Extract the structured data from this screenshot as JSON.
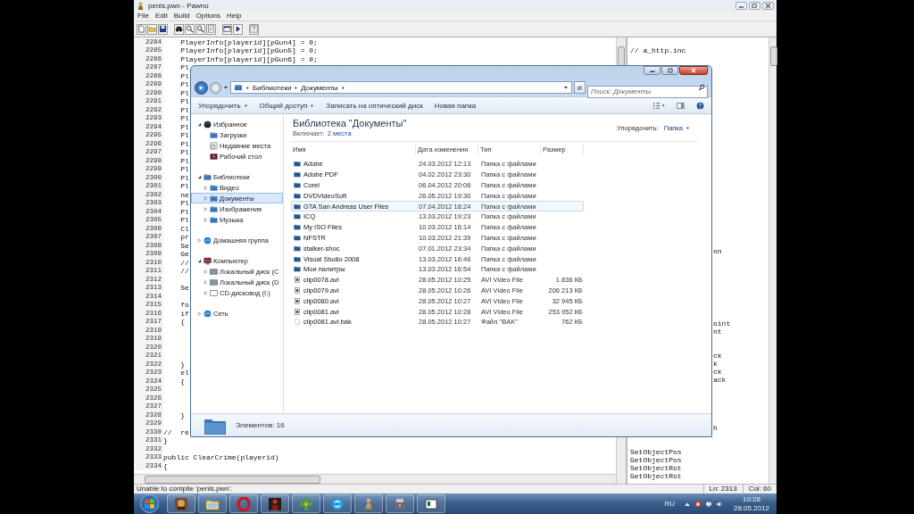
{
  "editor_window": {
    "title": "penls.pwn - Pawno",
    "menu": [
      "File",
      "Edit",
      "Build",
      "Options",
      "Help"
    ],
    "code_lines": [
      {
        "number": "2284",
        "text": "    PlayerInfo[playerid][pGun4] = 0;"
      },
      {
        "number": "2285",
        "text": "    PlayerInfo[playerid][pGun5] = 0;"
      },
      {
        "number": "2286",
        "text": "    PlayerInfo[playerid][pGun6] = 0;"
      },
      {
        "number": "2287",
        "text": "    Pl"
      },
      {
        "number": "2288",
        "text": "    Pl"
      },
      {
        "number": "2289",
        "text": "    Pl"
      },
      {
        "number": "2290",
        "text": "    Pl"
      },
      {
        "number": "2291",
        "text": "    Pl"
      },
      {
        "number": "2292",
        "text": "    Pl"
      },
      {
        "number": "2293",
        "text": "    Pl"
      },
      {
        "number": "2294",
        "text": "    Pl"
      },
      {
        "number": "2295",
        "text": "    Pl"
      },
      {
        "number": "2296",
        "text": "    Pl"
      },
      {
        "number": "2297",
        "text": "    Pl"
      },
      {
        "number": "2298",
        "text": "    Pl"
      },
      {
        "number": "2299",
        "text": "    Pl"
      },
      {
        "number": "2300",
        "text": "    Pl"
      },
      {
        "number": "2301",
        "text": "    Pl"
      },
      {
        "number": "2302",
        "text": "    ne"
      },
      {
        "number": "2303",
        "text": "    Pl"
      },
      {
        "number": "2304",
        "text": "    Pl"
      },
      {
        "number": "2305",
        "text": "    Pl"
      },
      {
        "number": "2306",
        "text": "    Cl"
      },
      {
        "number": "2307",
        "text": "    pr"
      },
      {
        "number": "2308",
        "text": "    Se"
      },
      {
        "number": "2309",
        "text": "    Ge"
      },
      {
        "number": "2310",
        "text": "    //"
      },
      {
        "number": "2311",
        "text": "    //"
      },
      {
        "number": "2312"
      },
      {
        "number": "2313",
        "text": "    Se"
      },
      {
        "number": "2314"
      },
      {
        "number": "2315",
        "text": "    fo"
      },
      {
        "number": "2316",
        "text": "    if"
      },
      {
        "number": "2317",
        "text": "    {"
      },
      {
        "number": "2318"
      },
      {
        "number": "2319"
      },
      {
        "number": "2320"
      },
      {
        "number": "2321"
      },
      {
        "number": "2322",
        "text": "    }"
      },
      {
        "number": "2323",
        "text": "    el"
      },
      {
        "number": "2324",
        "text": "    {"
      },
      {
        "number": "2325"
      },
      {
        "number": "2326"
      },
      {
        "number": "2327"
      },
      {
        "number": "2328",
        "text": "    }"
      },
      {
        "number": "2329"
      },
      {
        "number": "2330",
        "text": "//  re"
      },
      {
        "number": "2331",
        "text": "}"
      },
      {
        "number": "2332"
      },
      {
        "number": "2333",
        "text": "public ClearCrime(playerid)"
      },
      {
        "number": "2334",
        "text": "{"
      }
    ],
    "function_list": [
      {
        "kind": "text",
        "text": "// a_http.inc"
      },
      {
        "kind": "blank"
      },
      {
        "kind": "blank"
      },
      {
        "kind": "blank"
      },
      {
        "kind": "blank"
      },
      {
        "kind": "blank"
      },
      {
        "kind": "blank"
      },
      {
        "kind": "blank"
      },
      {
        "kind": "blank"
      },
      {
        "kind": "blank"
      },
      {
        "kind": "blank"
      },
      {
        "kind": "blank"
      },
      {
        "kind": "blank"
      },
      {
        "kind": "blank"
      },
      {
        "kind": "blank"
      },
      {
        "kind": "blank"
      },
      {
        "kind": "blank"
      },
      {
        "kind": "blank"
      },
      {
        "kind": "blank"
      },
      {
        "kind": "blank"
      },
      {
        "kind": "blank"
      },
      {
        "kind": "blank"
      },
      {
        "kind": "blank"
      },
      {
        "kind": "blank"
      },
      {
        "kind": "blank"
      },
      {
        "kind": "fragment",
        "text": "on"
      },
      {
        "kind": "blank"
      },
      {
        "kind": "blank"
      },
      {
        "kind": "blank"
      },
      {
        "kind": "blank"
      },
      {
        "kind": "blank"
      },
      {
        "kind": "blank"
      },
      {
        "kind": "blank"
      },
      {
        "kind": "blank"
      },
      {
        "kind": "fragment",
        "text": "oint"
      },
      {
        "kind": "fragment",
        "text": "nt"
      },
      {
        "kind": "blank"
      },
      {
        "kind": "blank"
      },
      {
        "kind": "fragment",
        "text": "ck"
      },
      {
        "kind": "fragment",
        "text": "k"
      },
      {
        "kind": "fragment",
        "text": "ck"
      },
      {
        "kind": "fragment",
        "text": "ack"
      },
      {
        "kind": "blank"
      },
      {
        "kind": "blank"
      },
      {
        "kind": "blank"
      },
      {
        "kind": "blank"
      },
      {
        "kind": "blank"
      },
      {
        "kind": "fragment",
        "text": "h"
      },
      {
        "kind": "blank"
      },
      {
        "kind": "blank"
      },
      {
        "kind": "text",
        "text": "SetObjectPos"
      },
      {
        "kind": "text",
        "text": "GetObjectPos"
      },
      {
        "kind": "text",
        "text": "SetObjectRot"
      },
      {
        "kind": "text",
        "text": "GetObjectRot"
      }
    ],
    "status": "Unable to compile 'penls.pwn'.",
    "position": [
      "Ln: 2313",
      "Col: 60"
    ]
  },
  "explorer_window": {
    "breadcrumb": [
      "Библиотеки",
      "Документы"
    ],
    "search": {
      "placeholder": "Поиск: Документы"
    },
    "toolbar": [
      {
        "label": "Упорядочить",
        "dropdown": true
      },
      {
        "label": "Общий доступ",
        "dropdown": true
      },
      {
        "label": "Записать на оптический диск",
        "dropdown": false
      },
      {
        "label": "Новая папка",
        "dropdown": false
      }
    ],
    "navigation": [
      {
        "kind": "favorites",
        "label": "Избранное",
        "expanded": true,
        "selected": false,
        "children": [
          {
            "kind": "folder",
            "label": "Загрузки",
            "selected": false
          },
          {
            "kind": "recent",
            "label": "Недавние места",
            "selected": false
          },
          {
            "kind": "desktop",
            "label": "Рабочий стол",
            "selected": false
          }
        ]
      },
      {
        "kind": "library",
        "label": "Библиотеки",
        "expanded": true,
        "selected": false,
        "children": [
          {
            "kind": "folder",
            "label": "Видео",
            "expanded": false,
            "selected": false
          },
          {
            "kind": "folder",
            "label": "Документы",
            "expanded": false,
            "selected": true
          },
          {
            "kind": "folder",
            "label": "Изображения",
            "expanded": false,
            "selected": false
          },
          {
            "kind": "folder",
            "label": "Музыка",
            "expanded": false,
            "selected": false
          }
        ]
      },
      {
        "kind": "globe",
        "label": "Домашняя группа",
        "expanded": false,
        "selected": false
      },
      {
        "kind": "computer",
        "label": "Компьютер",
        "expanded": true,
        "selected": false,
        "children": [
          {
            "kind": "drive",
            "label": "Локальный диск (C",
            "expanded": false,
            "selected": false
          },
          {
            "kind": "drive",
            "label": "Локальный диск (D",
            "expanded": false,
            "selected": false
          },
          {
            "kind": "cdrom",
            "label": "CD-дисковод (I:)",
            "expanded": false,
            "selected": false
          }
        ]
      },
      {
        "kind": "globe",
        "label": "Сеть",
        "expanded": false,
        "selected": false
      }
    ],
    "library": {
      "title": "Библиотека \"Документы\"",
      "includes_label": "Включает:",
      "includes_link": "2 места",
      "arrange_label": "Упорядочить:",
      "arrange_value": "Папка"
    },
    "columns": [
      "Имя",
      "Дата изменения",
      "Тип",
      "Размер"
    ],
    "files": [
      {
        "kind": "folder",
        "name": "Adobe",
        "date": "24.03.2012 12:13",
        "type": "Папка с файлами",
        "hovered": false
      },
      {
        "kind": "folder",
        "name": "Adobe PDF",
        "date": "04.02.2012 23:30",
        "type": "Папка с файлами",
        "hovered": false
      },
      {
        "kind": "folder",
        "name": "Corel",
        "date": "06.04.2012 20:06",
        "type": "Папка с файлами",
        "hovered": false
      },
      {
        "kind": "folder",
        "name": "DVDVideoSoft",
        "date": "26.05.2012 19:30",
        "type": "Папка с файлами",
        "hovered": false
      },
      {
        "kind": "folder",
        "name": "GTA San Andreas User Files",
        "date": "07.04.2012 18:24",
        "type": "Папка с файлами",
        "hovered": true
      },
      {
        "kind": "folder",
        "name": "ICQ",
        "date": "13.03.2012 19:23",
        "type": "Папка с файлами",
        "hovered": false
      },
      {
        "kind": "folder",
        "name": "My ISO Files",
        "date": "10.03.2012 16:14",
        "type": "Папка с файлами",
        "hovered": false
      },
      {
        "kind": "folder",
        "name": "NFSTR",
        "date": "10.03.2012 21:39",
        "type": "Папка с файлами",
        "hovered": false
      },
      {
        "kind": "folder",
        "name": "stalker-shoc",
        "date": "07.01.2012 23:34",
        "type": "Папка с файлами",
        "hovered": false
      },
      {
        "kind": "folder",
        "name": "Visual Studio 2008",
        "date": "13.03.2012 16:46",
        "type": "Папка с файлами",
        "hovered": false
      },
      {
        "kind": "folder",
        "name": "Мои палитры",
        "date": "13.03.2012 16:54",
        "type": "Папка с файлами",
        "hovered": false
      },
      {
        "kind": "video",
        "name": "clip0078.avi",
        "date": "28.05.2012 10:25",
        "type": "AVI Video File",
        "size": "1 836 КБ",
        "hovered": false
      },
      {
        "kind": "video",
        "name": "clip0079.avi",
        "date": "28.05.2012 10:26",
        "type": "AVI Video File",
        "size": "206 213 КБ",
        "hovered": false
      },
      {
        "kind": "video",
        "name": "clip0080.avi",
        "date": "28.05.2012 10:27",
        "type": "AVI Video File",
        "size": "32 945 КБ",
        "hovered": false
      },
      {
        "kind": "video",
        "name": "clip0081.avi",
        "date": "28.05.2012 10:28",
        "type": "AVI Video File",
        "size": "253 952 КБ",
        "hovered": false
      },
      {
        "kind": "file",
        "name": "clip0081.avi.bak",
        "date": "28.05.2012 10:27",
        "type": "Файл \"BAK\"",
        "size": "762 КБ",
        "hovered": false
      }
    ],
    "status": "Элементов: 16"
  },
  "taskbar": {
    "apps": [
      {
        "kind": "game"
      },
      {
        "kind": "explorer"
      },
      {
        "kind": "opera"
      },
      {
        "kind": "figure"
      },
      {
        "kind": "icq"
      },
      {
        "kind": "skype"
      },
      {
        "kind": "pawn"
      },
      {
        "kind": "tool"
      },
      {
        "kind": "window"
      }
    ],
    "language": "RU",
    "time": "10:28",
    "date": "28.05.2012"
  }
}
